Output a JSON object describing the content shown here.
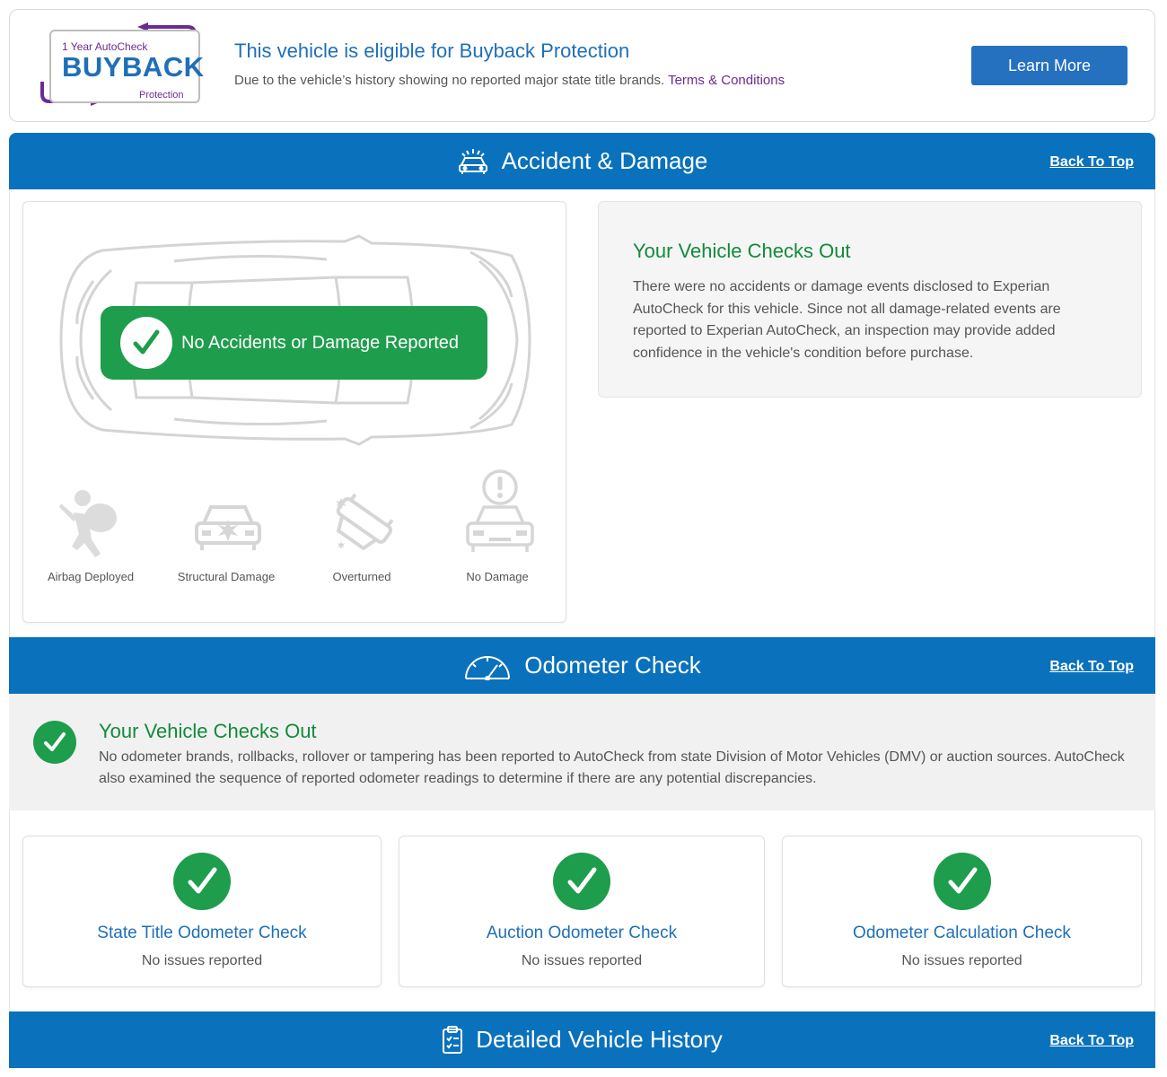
{
  "buyback": {
    "logo_line1": "1 Year AutoCheck",
    "logo_line2": "BUYBACK",
    "logo_line3": "Protection",
    "title": "This vehicle is eligible for Buyback Protection",
    "subtitle": "Due to the vehicle’s history showing no reported major state title brands.",
    "terms_link": "Terms & Conditions",
    "learn_more": "Learn More"
  },
  "accident": {
    "title": "Accident & Damage",
    "back_to_top": "Back To Top",
    "pill_text": "No Accidents or Damage Reported",
    "damage_types": [
      {
        "label": "Airbag Deployed",
        "icon": "airbag-icon"
      },
      {
        "label": "Structural Damage",
        "icon": "structural-damage-icon"
      },
      {
        "label": "Overturned",
        "icon": "overturned-icon"
      },
      {
        "label": "No Damage",
        "icon": "no-damage-icon"
      }
    ],
    "checks_title": "Your Vehicle Checks Out",
    "checks_text": "There were no accidents or damage events disclosed to Experian AutoCheck for this vehicle. Since not all damage-related events are reported to Experian AutoCheck, an inspection may provide added confidence in the vehicle's condition before purchase."
  },
  "odometer": {
    "title": "Odometer Check",
    "back_to_top": "Back To Top",
    "checks_title": "Your Vehicle Checks Out",
    "checks_text": "No odometer brands, rollbacks, rollover or tampering has been reported to AutoCheck from state Division of Motor Vehicles (DMV) or auction sources. AutoCheck also examined the sequence of reported odometer readings to determine if there are any potential discrepancies.",
    "cards": [
      {
        "title": "State Title Odometer Check",
        "status": "No issues reported"
      },
      {
        "title": "Auction Odometer Check",
        "status": "No issues reported"
      },
      {
        "title": "Odometer Calculation Check",
        "status": "No issues reported"
      }
    ]
  },
  "history": {
    "title": "Detailed Vehicle History",
    "back_to_top": "Back To Top"
  },
  "colors": {
    "header_blue": "#0a71bd",
    "success_green": "#1e9d4c",
    "title_blue": "#1f6fb8",
    "brand_purple": "#6a2c91"
  }
}
